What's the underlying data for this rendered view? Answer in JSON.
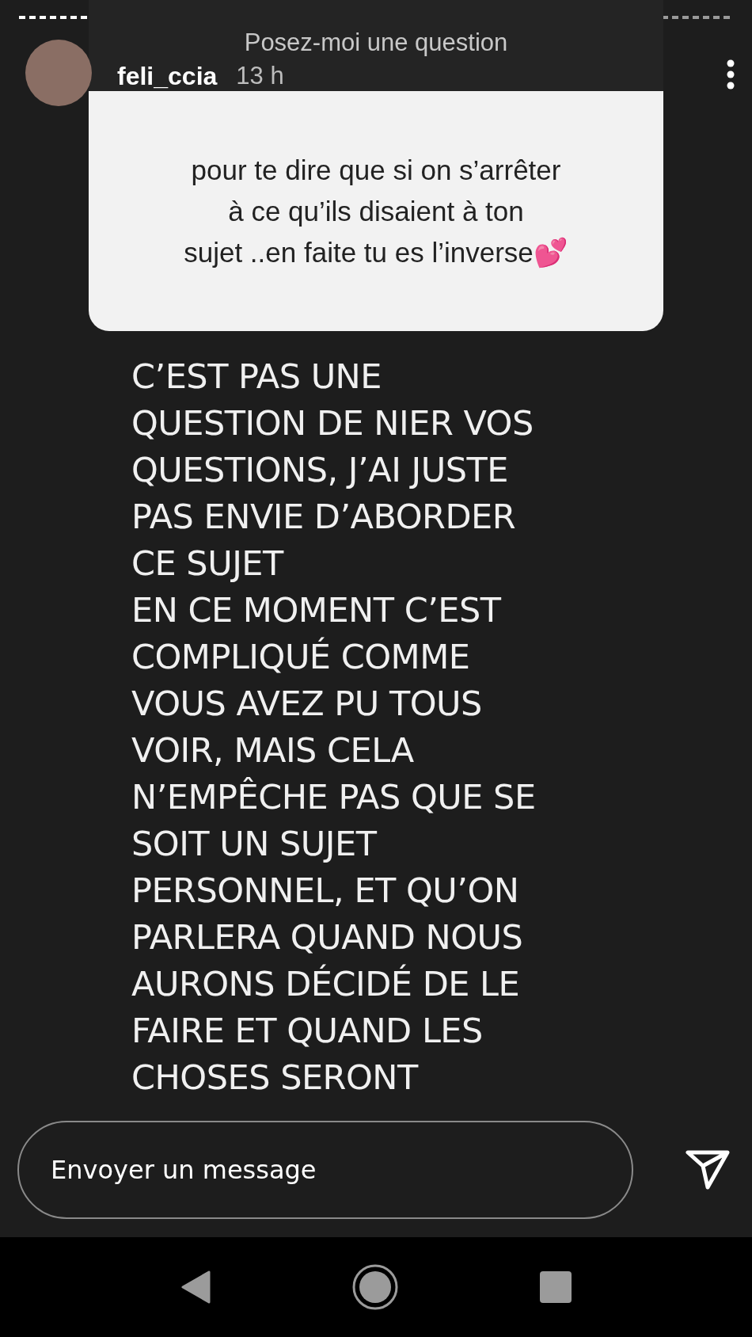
{
  "story": {
    "prompt_label": "Posez-moi une question",
    "username": "feli_ccia",
    "time": "13 h"
  },
  "question_card": {
    "text": "pour te dire que si on s’arrêter\nà ce qu’ils disaient à ton\nsujet ..en faite tu es l’inverse💕"
  },
  "story_text": "C’EST PAS UNE\nQUESTION DE NIER VOS\nQUESTIONS, J’AI JUSTE\nPAS ENVIE D’ABORDER\nCE SUJET\nEN CE MOMENT C’EST\nCOMPLIQUÉ COMME\nVOUS AVEZ PU TOUS\nVOIR, MAIS CELA\nN’EMPÊCHE PAS QUE SE\nSOIT UN SUJET\nPERSONNEL, ET QU’ON\nPARLERA QUAND NOUS\nAURONS DÉCIDÉ DE LE\nFAIRE ET QUAND LES\nCHOSES SERONT",
  "reply": {
    "placeholder": "Envoyer un message"
  }
}
